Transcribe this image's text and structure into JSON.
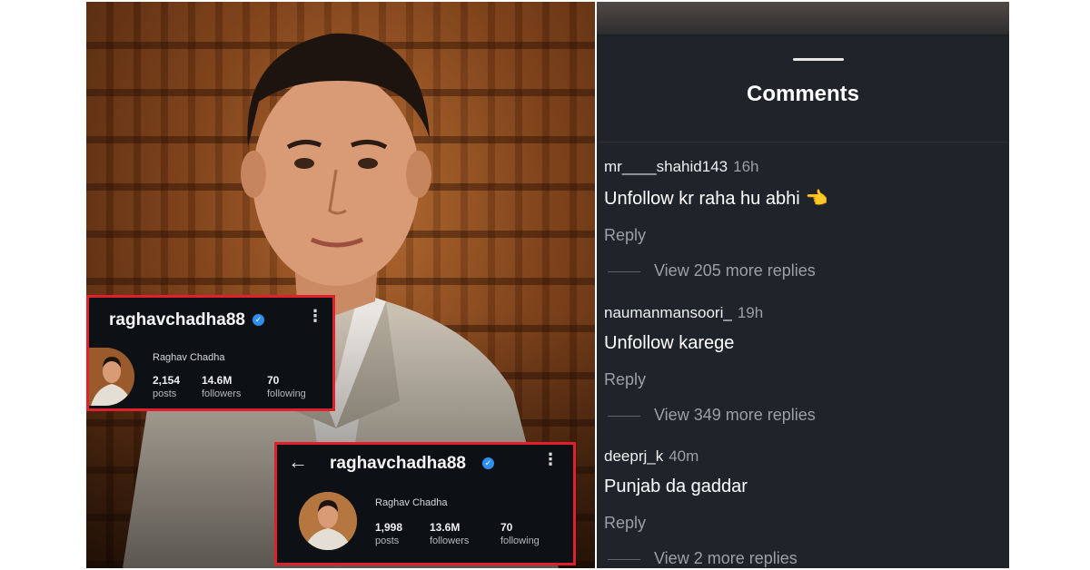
{
  "profile_cards": [
    {
      "username": "raghavchadha88",
      "name": "Raghav Chadha",
      "stats": [
        {
          "value": "2,154",
          "label": "posts"
        },
        {
          "value": "14.6M",
          "label": "followers"
        },
        {
          "value": "70",
          "label": "following"
        }
      ]
    },
    {
      "username": "raghavchadha88",
      "name": "Raghav Chadha",
      "stats": [
        {
          "value": "1,998",
          "label": "posts"
        },
        {
          "value": "13.6M",
          "label": "followers"
        },
        {
          "value": "70",
          "label": "following"
        }
      ]
    }
  ],
  "comments_sheet": {
    "title": "Comments",
    "comments": [
      {
        "user": "mr____shahid143",
        "time": "16h",
        "text": "Unfollow kr raha hu abhi",
        "reply_label": "Reply",
        "view_replies": "View 205 more replies"
      },
      {
        "user": "naumanmansoori_",
        "time": "19h",
        "text": "Unfollow karege",
        "reply_label": "Reply",
        "view_replies": "View 349 more replies"
      },
      {
        "user": "deeprj_k",
        "time": "40m",
        "text": "Punjab da gaddar",
        "reply_label": "Reply",
        "view_replies": "View 2 more replies"
      }
    ]
  },
  "colors": {
    "highlight_border": "#e0202c",
    "verified_badge": "#2f8ff0",
    "sheet_background": "#1f242b"
  },
  "icons": [
    "verified-badge-icon",
    "kebab-menu-icon",
    "back-arrow-icon",
    "pointing-hand-emoji"
  ]
}
